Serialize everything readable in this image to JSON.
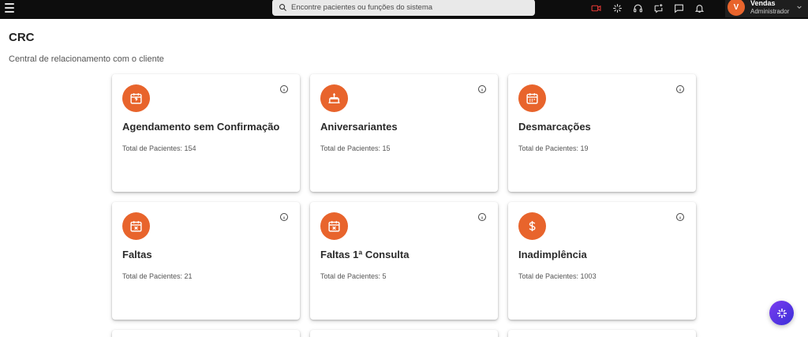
{
  "topbar": {
    "search_placeholder": "Encontre pacientes ou funções do sistema",
    "user": {
      "initial": "V",
      "name": "Vendas",
      "role": "Administrador"
    }
  },
  "page": {
    "title": "CRC",
    "subtitle": "Central de relacionamento com o cliente"
  },
  "cards": [
    {
      "title": "Agendamento sem Confirmação",
      "total": "Total de Pacientes: 154",
      "icon": "calendar-question-icon"
    },
    {
      "title": "Aniversariantes",
      "total": "Total de Pacientes: 15",
      "icon": "cake-icon"
    },
    {
      "title": "Desmarcações",
      "total": "Total de Pacientes: 19",
      "icon": "calendar-icon"
    },
    {
      "title": "Faltas",
      "total": "Total de Pacientes: 21",
      "icon": "calendar-x-icon"
    },
    {
      "title": "Faltas 1ª Consulta",
      "total": "Total de Pacientes: 5",
      "icon": "calendar-x-icon"
    },
    {
      "title": "Inadimplência",
      "total": "Total de Pacientes: 1003",
      "icon": "dollar-icon"
    }
  ],
  "colors": {
    "accent": "#e8642c",
    "topbar": "#0d0d0d",
    "video_icon": "#e53935"
  }
}
